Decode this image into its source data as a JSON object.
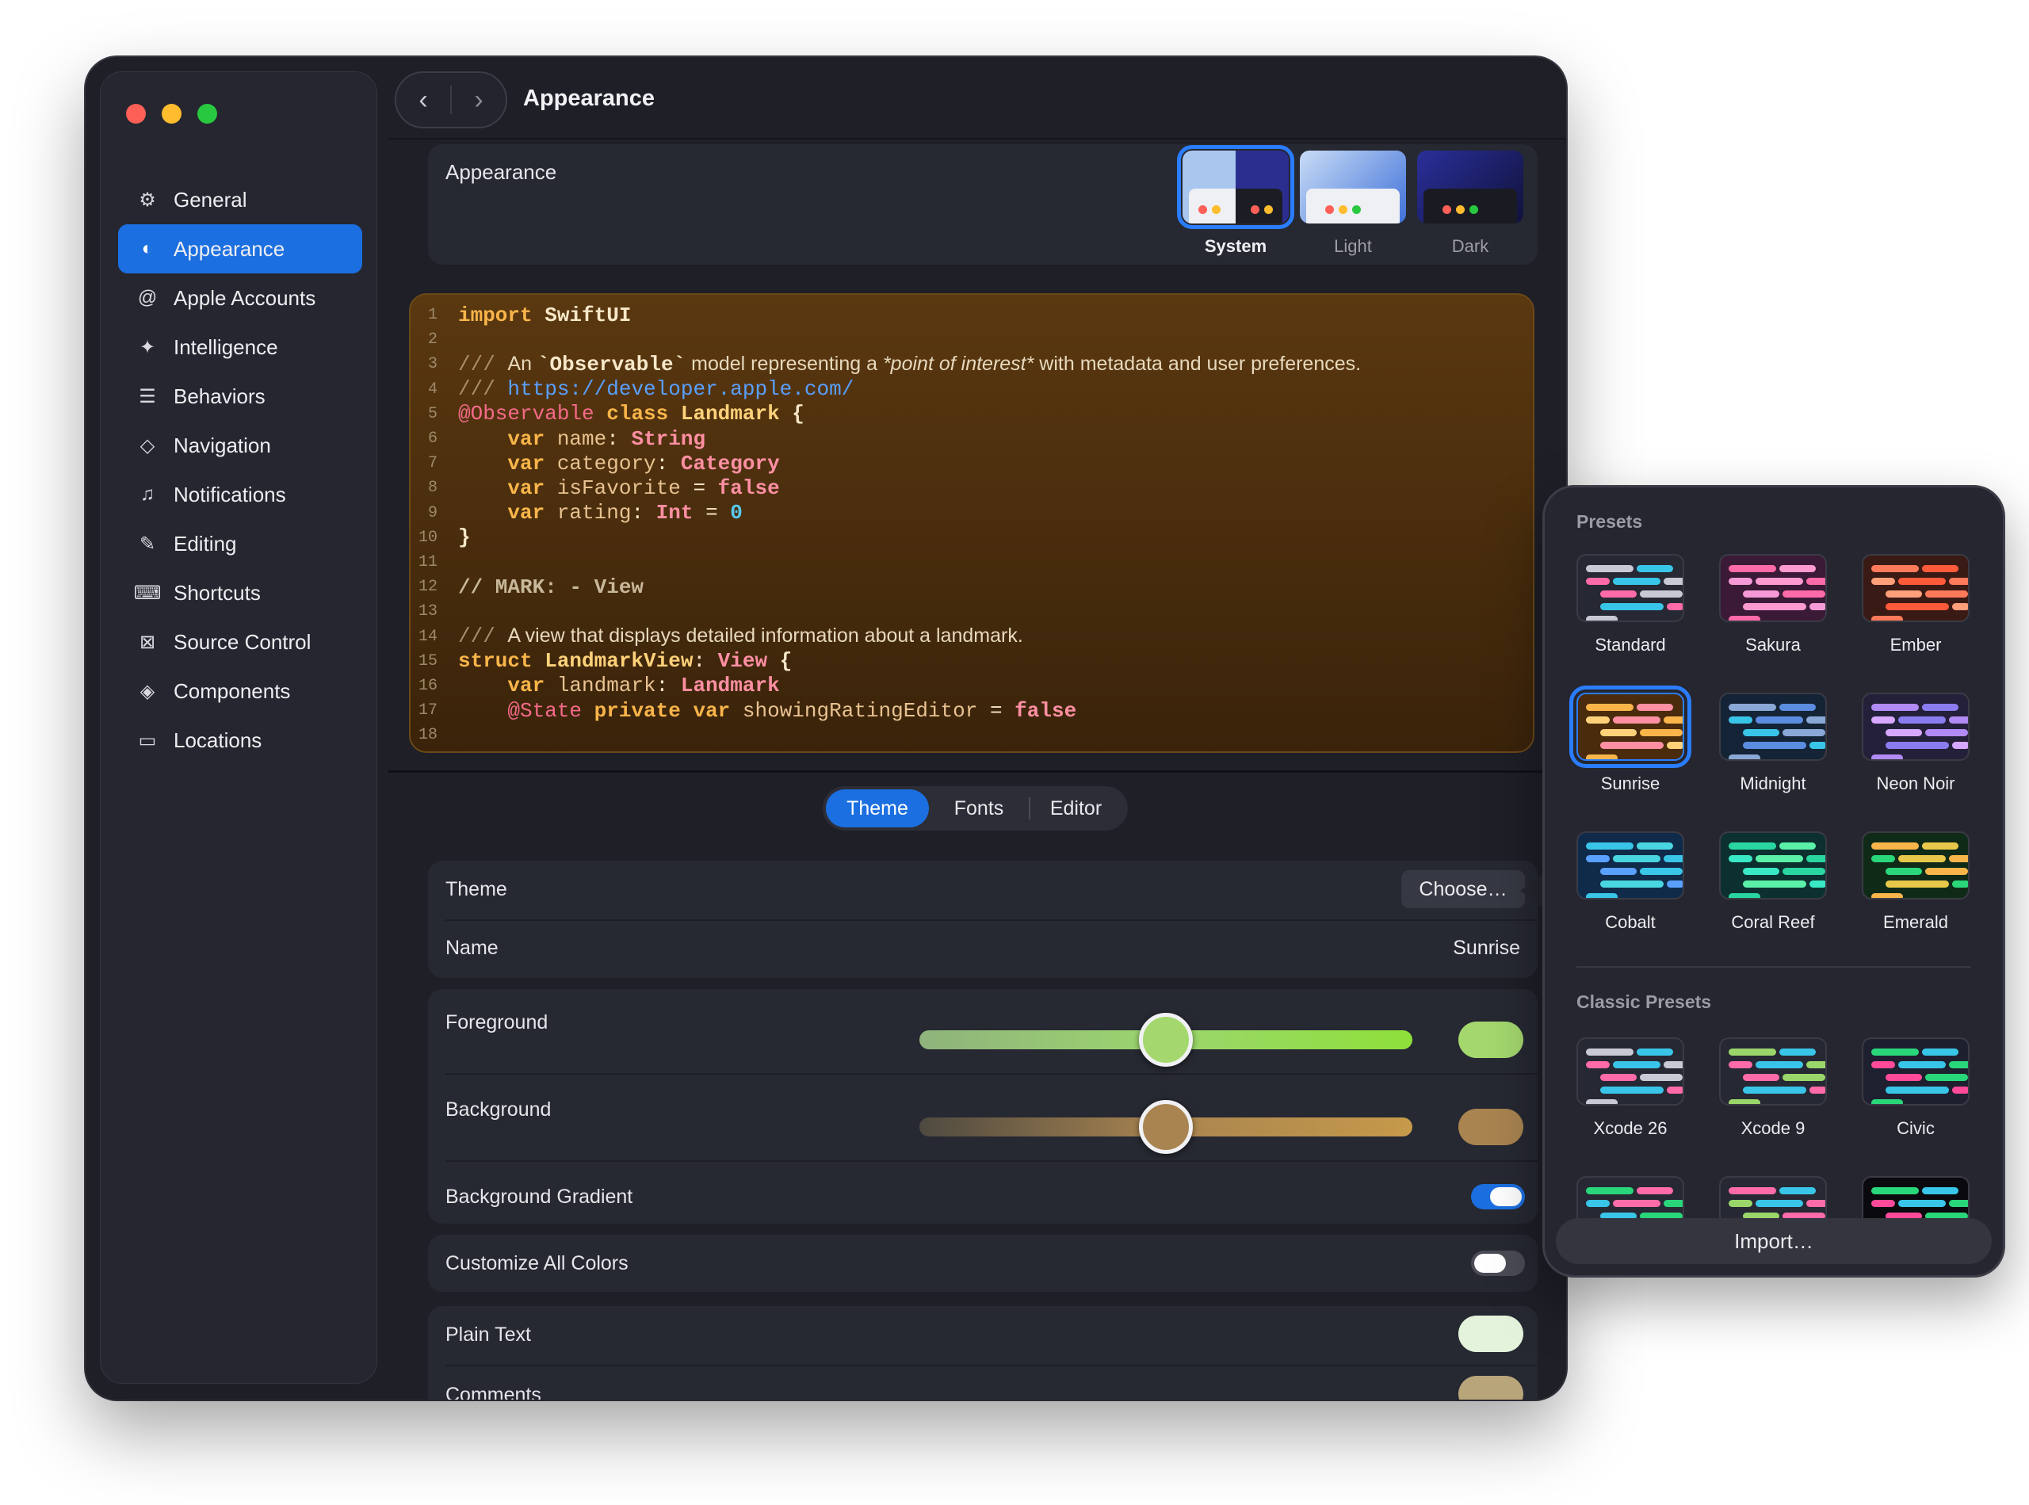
{
  "window": {
    "title": "Appearance"
  },
  "sidebar": {
    "items": [
      {
        "label": "General",
        "icon": "gear-icon"
      },
      {
        "label": "Appearance",
        "icon": "appearance-icon"
      },
      {
        "label": "Apple Accounts",
        "icon": "at-icon"
      },
      {
        "label": "Intelligence",
        "icon": "sparkle-icon"
      },
      {
        "label": "Behaviors",
        "icon": "behaviors-icon"
      },
      {
        "label": "Navigation",
        "icon": "navigation-icon"
      },
      {
        "label": "Notifications",
        "icon": "bell-icon"
      },
      {
        "label": "Editing",
        "icon": "pencil-icon"
      },
      {
        "label": "Shortcuts",
        "icon": "keyboard-icon"
      },
      {
        "label": "Source Control",
        "icon": "source-control-icon"
      },
      {
        "label": "Components",
        "icon": "layers-icon"
      },
      {
        "label": "Locations",
        "icon": "drive-icon"
      }
    ],
    "active_index": 1
  },
  "appearance": {
    "label": "Appearance",
    "options": [
      {
        "label": "System",
        "selected": true
      },
      {
        "label": "Light",
        "selected": false
      },
      {
        "label": "Dark",
        "selected": false
      }
    ]
  },
  "code": {
    "line_numbers": [
      "1",
      "2",
      "3",
      "4",
      "5",
      "6",
      "7",
      "8",
      "9",
      "10",
      "11",
      "12",
      "13",
      "14",
      "15",
      "16",
      "17",
      "18"
    ],
    "lines": [
      [
        {
          "t": "import ",
          "c": "#f9b54a",
          "b": true
        },
        {
          "t": "SwiftUI",
          "c": "#f7e7c9",
          "b": true
        }
      ],
      [],
      [
        {
          "t": "/// ",
          "c": "#a88f6e"
        },
        {
          "t": "An ",
          "c": "#e8d9bd",
          "s": true
        },
        {
          "t": "`Observable`",
          "c": "#f7e7c9",
          "b": true
        },
        {
          "t": " model representing a ",
          "c": "#e8d9bd",
          "s": true
        },
        {
          "t": "*point of interest*",
          "c": "#e8d9bd",
          "s": true,
          "i": true
        },
        {
          "t": " with metadata and user preferences.",
          "c": "#e8d9bd",
          "s": true
        }
      ],
      [
        {
          "t": "/// ",
          "c": "#a88f6e"
        },
        {
          "t": "https://developer.apple.com/",
          "c": "#5aa0ff"
        }
      ],
      [
        {
          "t": "@Observable ",
          "c": "#f56a8a"
        },
        {
          "t": "class ",
          "c": "#f9b54a",
          "b": true
        },
        {
          "t": "Landmark",
          "c": "#ffd27a",
          "b": true
        },
        {
          "t": " {",
          "c": "#f7e7c9",
          "b": true
        }
      ],
      [
        {
          "t": "    var ",
          "c": "#f9b54a",
          "b": true
        },
        {
          "t": "name",
          "c": "#e8c291"
        },
        {
          "t": ": ",
          "c": "#f7e7c9"
        },
        {
          "t": "String",
          "c": "#ff8fa3",
          "b": true
        }
      ],
      [
        {
          "t": "    var ",
          "c": "#f9b54a",
          "b": true
        },
        {
          "t": "category",
          "c": "#e8c291"
        },
        {
          "t": ": ",
          "c": "#f7e7c9"
        },
        {
          "t": "Category",
          "c": "#ff8fa3",
          "b": true
        }
      ],
      [
        {
          "t": "    var ",
          "c": "#f9b54a",
          "b": true
        },
        {
          "t": "isFavorite",
          "c": "#e8c291"
        },
        {
          "t": " = ",
          "c": "#f7e7c9"
        },
        {
          "t": "false",
          "c": "#ff8fa3",
          "b": true
        }
      ],
      [
        {
          "t": "    var ",
          "c": "#f9b54a",
          "b": true
        },
        {
          "t": "rating",
          "c": "#e8c291"
        },
        {
          "t": ": ",
          "c": "#f7e7c9"
        },
        {
          "t": "Int",
          "c": "#ff8fa3",
          "b": true
        },
        {
          "t": " = ",
          "c": "#f7e7c9"
        },
        {
          "t": "0",
          "c": "#58c9f0",
          "b": true
        }
      ],
      [
        {
          "t": "}",
          "c": "#f7e7c9",
          "b": true
        }
      ],
      [],
      [
        {
          "t": "// MARK: - View",
          "c": "#c8b89b",
          "b": true
        }
      ],
      [],
      [
        {
          "t": "/// ",
          "c": "#a88f6e"
        },
        {
          "t": "A view that displays detailed information about a landmark.",
          "c": "#e8d9bd",
          "s": true
        }
      ],
      [
        {
          "t": "struct ",
          "c": "#f9b54a",
          "b": true
        },
        {
          "t": "LandmarkView",
          "c": "#ffd27a",
          "b": true
        },
        {
          "t": ": ",
          "c": "#f7e7c9"
        },
        {
          "t": "View",
          "c": "#ff8fa3",
          "b": true
        },
        {
          "t": " {",
          "c": "#f7e7c9",
          "b": true
        }
      ],
      [
        {
          "t": "    var ",
          "c": "#f9b54a",
          "b": true
        },
        {
          "t": "landmark",
          "c": "#e8c291"
        },
        {
          "t": ": ",
          "c": "#f7e7c9"
        },
        {
          "t": "Landmark",
          "c": "#ff8fa3",
          "b": true
        }
      ],
      [
        {
          "t": "    @State ",
          "c": "#f56a8a"
        },
        {
          "t": "private ",
          "c": "#f9b54a",
          "b": true
        },
        {
          "t": "var ",
          "c": "#f9b54a",
          "b": true
        },
        {
          "t": "showingRatingEditor",
          "c": "#e8c291"
        },
        {
          "t": " = ",
          "c": "#f7e7c9"
        },
        {
          "t": "false",
          "c": "#ff8fa3",
          "b": true
        }
      ],
      []
    ]
  },
  "tabs": [
    {
      "label": "Theme",
      "selected": true
    },
    {
      "label": "Fonts",
      "selected": false
    },
    {
      "label": "Editor",
      "selected": false
    }
  ],
  "theme": {
    "theme_label": "Theme",
    "choose_label": "Choose…",
    "name_label": "Name",
    "name_value": "Sunrise"
  },
  "colors": {
    "foreground_label": "Foreground",
    "foreground_level": 0.5,
    "foreground_color": "#a4d86e",
    "background_label": "Background",
    "background_level": 0.5,
    "background_color": "#a98450",
    "gradient_label": "Background Gradient",
    "gradient_on": true
  },
  "customize": {
    "label": "Customize All Colors",
    "on": false
  },
  "plain_text": {
    "label": "Plain Text",
    "color": "#e4f4dc"
  },
  "comments": {
    "label": "Comments",
    "color": "#b9a57a"
  },
  "presets": {
    "heading": "Presets",
    "items": [
      {
        "label": "Standard",
        "bg": "#262833",
        "colors": [
          "#c9c9d6",
          "#ff6aa8",
          "#39c5e8"
        ],
        "selected": false
      },
      {
        "label": "Sakura",
        "bg": "#3a1a36",
        "colors": [
          "#ff6aa8",
          "#f59ad6",
          "#ff9ad1"
        ],
        "selected": false
      },
      {
        "label": "Ember",
        "bg": "#3a1a14",
        "colors": [
          "#ff7a5a",
          "#ffa07a",
          "#ff5a3a"
        ],
        "selected": false
      },
      {
        "label": "Sunrise",
        "bg": "#4a2c0c",
        "colors": [
          "#f9b54a",
          "#ffd27a",
          "#ff8fa3"
        ],
        "selected": true
      },
      {
        "label": "Midnight",
        "bg": "#142436",
        "colors": [
          "#8aa8d6",
          "#39c5e8",
          "#5a8de0"
        ],
        "selected": false
      },
      {
        "label": "Neon Noir",
        "bg": "#24203a",
        "colors": [
          "#b28af5",
          "#d6a8ff",
          "#8a7cf0"
        ],
        "selected": false
      },
      {
        "label": "Cobalt",
        "bg": "#102a4a",
        "colors": [
          "#39c5e8",
          "#5aa0ff",
          "#4ad6e0"
        ],
        "selected": false
      },
      {
        "label": "Coral Reef",
        "bg": "#0c3030",
        "colors": [
          "#2ad6a0",
          "#39e8c5",
          "#5af0a8"
        ],
        "selected": false
      },
      {
        "label": "Emerald",
        "bg": "#102a18",
        "colors": [
          "#f9b54a",
          "#2ad67a",
          "#e8c84a"
        ],
        "selected": false
      }
    ]
  },
  "classic_presets": {
    "heading": "Classic Presets",
    "items": [
      {
        "label": "Xcode 26",
        "bg": "#262833",
        "colors": [
          "#c9c9d6",
          "#ff6aa8",
          "#39c5e8"
        ]
      },
      {
        "label": "Xcode 9",
        "bg": "#262833",
        "colors": [
          "#9ad66a",
          "#ff6aa8",
          "#39c5e8"
        ]
      },
      {
        "label": "Civic",
        "bg": "#1e2030",
        "colors": [
          "#2ad67a",
          "#ff4a9a",
          "#39c5e8"
        ]
      },
      {
        "label": "",
        "bg": "#262833",
        "colors": [
          "#2ad67a",
          "#39c5e8",
          "#ff6aa8"
        ]
      },
      {
        "label": "",
        "bg": "#262833",
        "colors": [
          "#ff6aa8",
          "#9ad66a",
          "#39c5e8"
        ]
      },
      {
        "label": "",
        "bg": "#0a0a0e",
        "colors": [
          "#2ad67a",
          "#ff4a9a",
          "#39c5e8"
        ]
      }
    ]
  },
  "import_label": "Import…"
}
